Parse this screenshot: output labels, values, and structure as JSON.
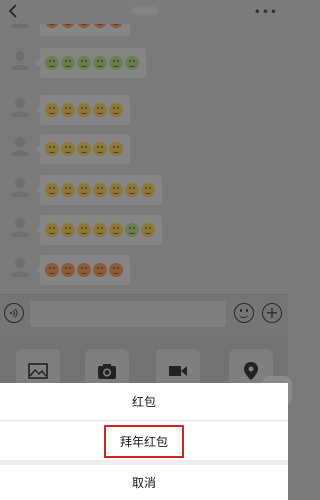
{
  "header": {
    "title": ""
  },
  "messages": [
    {
      "emojis": [
        "red",
        "red",
        "red",
        "red",
        "red"
      ]
    },
    {
      "emojis": [
        "green",
        "green",
        "green",
        "green",
        "green",
        "green"
      ]
    },
    {
      "emojis": [
        "yellow",
        "yellow",
        "yellow",
        "yellow",
        "yellow"
      ]
    },
    {
      "emojis": [
        "yellow",
        "yellow",
        "yellow",
        "yellow",
        "yellow"
      ]
    },
    {
      "emojis": [
        "yellow",
        "yellow",
        "yellow",
        "yellow",
        "yellow",
        "yellow",
        "yellow"
      ]
    },
    {
      "emojis": [
        "yellow",
        "yellow",
        "yellow",
        "yellow",
        "shades",
        "green",
        "yellow"
      ]
    },
    {
      "emojis": [
        "red",
        "red",
        "red",
        "red",
        "red"
      ]
    }
  ],
  "input": {
    "placeholder": ""
  },
  "tools": [
    "image-icon",
    "camera-icon",
    "video-icon",
    "location-icon"
  ],
  "action_sheet": {
    "item1": "红包",
    "item2": "拜年红包",
    "cancel": "取消"
  },
  "colors": {
    "highlight": "#d32424"
  }
}
